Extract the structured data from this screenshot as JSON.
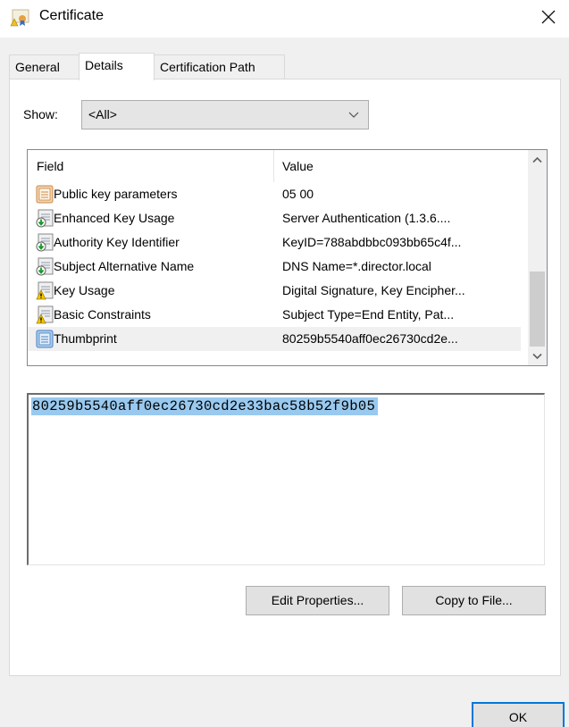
{
  "window": {
    "title": "Certificate",
    "close_label": "Close"
  },
  "tabs": [
    {
      "label": "General",
      "active": false
    },
    {
      "label": "Details",
      "active": true
    },
    {
      "label": "Certification Path",
      "active": false
    }
  ],
  "show": {
    "label": "Show:",
    "selected": "<All>"
  },
  "list": {
    "columns": {
      "field": "Field",
      "value": "Value"
    },
    "rows": [
      {
        "field": "Public key parameters",
        "value": "05 00",
        "icon": "public-key-icon"
      },
      {
        "field": "Enhanced Key Usage",
        "value": "Server Authentication (1.3.6....",
        "icon": "extension-icon"
      },
      {
        "field": "Authority Key Identifier",
        "value": "KeyID=788abdbbc093bb65c4f...",
        "icon": "extension-icon"
      },
      {
        "field": "Subject Alternative Name",
        "value": "DNS Name=*.director.local",
        "icon": "extension-icon"
      },
      {
        "field": "Key Usage",
        "value": "Digital Signature, Key Encipher...",
        "icon": "critical-extension-icon"
      },
      {
        "field": "Basic Constraints",
        "value": "Subject Type=End Entity, Pat...",
        "icon": "critical-extension-icon"
      },
      {
        "field": "Thumbprint",
        "value": "80259b5540aff0ec26730cd2e...",
        "icon": "property-icon",
        "selected": true
      }
    ]
  },
  "detail": {
    "value": "80259b5540aff0ec26730cd2e33bac58b52f9b05"
  },
  "buttons": {
    "edit_properties": "Edit Properties...",
    "copy_to_file": "Copy to File...",
    "ok": "OK"
  },
  "colors": {
    "accent": "#0078d7",
    "selection": "#99c9ef",
    "dialog_bg": "#f0f0f0"
  }
}
